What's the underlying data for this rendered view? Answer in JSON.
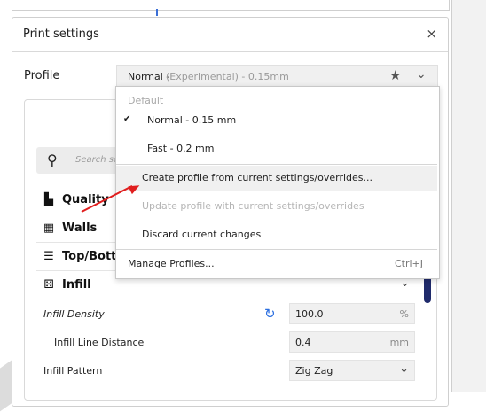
{
  "panel": {
    "title": "Print settings",
    "close": "×"
  },
  "profile": {
    "label": "Profile",
    "selected_name": "Normal -",
    "selected_sub": "(Experimental) - 0.15mm",
    "star": "★",
    "chevron": "⌄"
  },
  "search": {
    "placeholder": "Search se"
  },
  "categories": [
    {
      "label": "Quality",
      "icon": "quality-icon"
    },
    {
      "label": "Walls",
      "icon": "walls-icon"
    },
    {
      "label": "Top/Botto",
      "icon": "top-bottom-icon"
    },
    {
      "label": "Infill",
      "icon": "infill-icon"
    }
  ],
  "infill": {
    "density": {
      "label": "Infill Density",
      "value": "100.0",
      "unit": "%"
    },
    "line_distance": {
      "label": "Infill Line Distance",
      "value": "0.4",
      "unit": "mm"
    },
    "pattern": {
      "label": "Infill Pattern",
      "value": "Zig Zag"
    }
  },
  "dropdown": {
    "header": "Default",
    "items": [
      {
        "label": "Normal - 0.15 mm",
        "checked": true
      },
      {
        "label": "Fast - 0.2 mm"
      }
    ],
    "actions": [
      {
        "label": "Create profile from current settings/overrides..."
      },
      {
        "label": "Update profile with current settings/overrides",
        "disabled": true
      },
      {
        "label": "Discard current changes"
      }
    ],
    "manage": {
      "label": "Manage Profiles...",
      "shortcut": "Ctrl+J"
    }
  },
  "colors": {
    "accent": "#2c6fe0",
    "arrow": "#e01e1e",
    "scroll": "#1f2a6b"
  }
}
